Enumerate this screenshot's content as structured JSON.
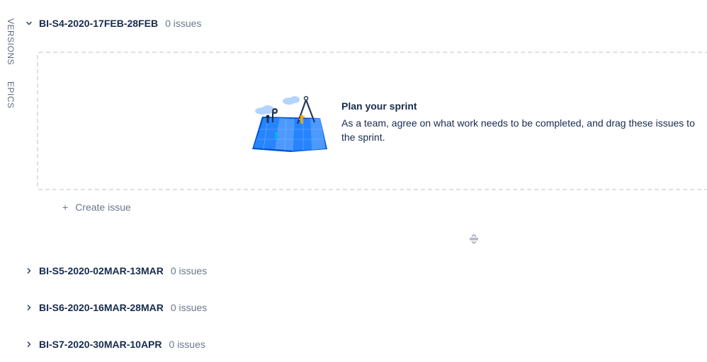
{
  "side_tabs": {
    "versions": "VERSIONS",
    "epics": "EPICS"
  },
  "sprints": [
    {
      "name": "BI-S4-2020-17FEB-28FEB",
      "count": "0 issues",
      "expanded": true
    },
    {
      "name": "BI-S5-2020-02MAR-13MAR",
      "count": "0 issues",
      "expanded": false
    },
    {
      "name": "BI-S6-2020-16MAR-28MAR",
      "count": "0 issues",
      "expanded": false
    },
    {
      "name": "BI-S7-2020-30MAR-10APR",
      "count": "0 issues",
      "expanded": false
    }
  ],
  "empty_state": {
    "title": "Plan your sprint",
    "description": "As a team, agree on what work needs to be completed, and drag these issues to the sprint."
  },
  "create_issue": {
    "icon": "plus-icon",
    "label": "Create issue"
  },
  "colors": {
    "text": "#172b4d",
    "muted": "#6b778c",
    "dashed_border": "#dfe1e6",
    "map_blue": "#2684ff"
  }
}
